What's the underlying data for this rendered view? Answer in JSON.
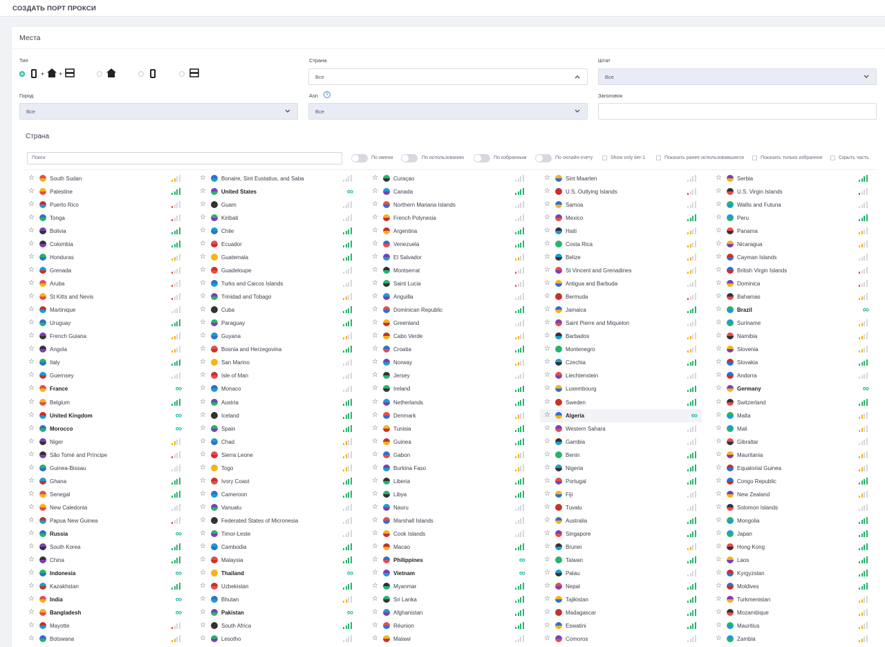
{
  "page_title": "СОЗДАТЬ ПОРТ ПРОКСИ",
  "card_title": "Места",
  "filters": {
    "type_label": "Тип",
    "country_label": "Страна",
    "country_value": "Все",
    "state_label": "Штат",
    "state_value": "Все",
    "city_label": "Город",
    "city_value": "Все",
    "asn_label": "Asn",
    "asn_value": "Все",
    "header_label": "Заголовок",
    "header_value": ""
  },
  "country_section": {
    "title": "Страна",
    "search_placeholder": "Поиск",
    "toggles": [
      "По имени",
      "По использованию",
      "По избранным",
      "По онлайн-счету"
    ],
    "checkboxes": [
      "Show only tier-1",
      "Показать ранее использовавшиеся",
      "Показать только избранное",
      "Скрыть часть"
    ]
  },
  "colors": {
    "accent": "#1fb7a0",
    "green": "#27b36b",
    "orange": "#f5b21a",
    "red": "#e84c4c",
    "grey": "#d5d7dd"
  },
  "columns": [
    [
      {
        "n": "South Sudan",
        "s": "o1"
      },
      {
        "n": "Palestine",
        "s": "g4"
      },
      {
        "n": "Puerto Rico",
        "s": "r1"
      },
      {
        "n": "Tonga",
        "s": "r1"
      },
      {
        "n": "Bolivia",
        "s": "g4"
      },
      {
        "n": "Colombia",
        "s": "g4"
      },
      {
        "n": "Honduras",
        "s": "o2"
      },
      {
        "n": "Grenada",
        "s": "r1"
      },
      {
        "n": "Aruba",
        "s": "r1"
      },
      {
        "n": "St Kitts and Nevis",
        "s": "r1"
      },
      {
        "n": "Martinique",
        "s": "x0"
      },
      {
        "n": "Uruguay",
        "s": "g4"
      },
      {
        "n": "French Guiana",
        "s": "o2"
      },
      {
        "n": "Angola",
        "s": "o2"
      },
      {
        "n": "Italy",
        "s": "g4"
      },
      {
        "n": "Guernsey",
        "s": "x0"
      },
      {
        "n": "France",
        "s": "inf",
        "b": true
      },
      {
        "n": "Belgium",
        "s": "g4"
      },
      {
        "n": "United Kingdom",
        "s": "inf",
        "b": true
      },
      {
        "n": "Morocco",
        "s": "inf",
        "b": true
      },
      {
        "n": "Niger",
        "s": "o2"
      },
      {
        "n": "São Tomé and Príncipe",
        "s": "r1"
      },
      {
        "n": "Guinea-Bissau",
        "s": "x0"
      },
      {
        "n": "Ghana",
        "s": "g4"
      },
      {
        "n": "Senegal",
        "s": "g4"
      },
      {
        "n": "New Caledonia",
        "s": "x0"
      },
      {
        "n": "Papua New Guinea",
        "s": "r1"
      },
      {
        "n": "Russia",
        "s": "inf",
        "b": true
      },
      {
        "n": "South Korea",
        "s": "g4"
      },
      {
        "n": "China",
        "s": "g4"
      },
      {
        "n": "Indonesia",
        "s": "inf",
        "b": true
      },
      {
        "n": "Kazakhstan",
        "s": "g4"
      },
      {
        "n": "India",
        "s": "inf",
        "b": true
      },
      {
        "n": "Bangladesh",
        "s": "inf",
        "b": true
      },
      {
        "n": "Mayotte",
        "s": "r1"
      },
      {
        "n": "Botswana",
        "s": "o2"
      }
    ],
    [
      {
        "n": "Bonaire, Sint Eustatius, and Saba",
        "s": "x0"
      },
      {
        "n": "United States",
        "s": "inf",
        "b": true
      },
      {
        "n": "Guam",
        "s": "x0"
      },
      {
        "n": "Kiribati",
        "s": "x0"
      },
      {
        "n": "Chile",
        "s": "g4"
      },
      {
        "n": "Ecuador",
        "s": "g4"
      },
      {
        "n": "Guatemala",
        "s": "g4"
      },
      {
        "n": "Guadeloupe",
        "s": "x0"
      },
      {
        "n": "Turks and Caicos Islands",
        "s": "x0"
      },
      {
        "n": "Trinidad and Tobago",
        "s": "o2"
      },
      {
        "n": "Cuba",
        "s": "g4"
      },
      {
        "n": "Paraguay",
        "s": "g4"
      },
      {
        "n": "Guyana",
        "s": "o2"
      },
      {
        "n": "Bosnia and Herzegovina",
        "s": "g4"
      },
      {
        "n": "San Marino",
        "s": "x0"
      },
      {
        "n": "Isle of Man",
        "s": "x0"
      },
      {
        "n": "Monaco",
        "s": "x0"
      },
      {
        "n": "Austria",
        "s": "g4"
      },
      {
        "n": "Iceland",
        "s": "g4"
      },
      {
        "n": "Spain",
        "s": "g4"
      },
      {
        "n": "Chad",
        "s": "o2"
      },
      {
        "n": "Sierra Leone",
        "s": "o2"
      },
      {
        "n": "Togo",
        "s": "o2"
      },
      {
        "n": "Ivory Coast",
        "s": "g4"
      },
      {
        "n": "Cameroon",
        "s": "g4"
      },
      {
        "n": "Vanuatu",
        "s": "x0"
      },
      {
        "n": "Federated States of Micronesia",
        "s": "x0"
      },
      {
        "n": "Timor-Leste",
        "s": "x0"
      },
      {
        "n": "Cambodia",
        "s": "g4"
      },
      {
        "n": "Malaysia",
        "s": "g4"
      },
      {
        "n": "Thailand",
        "s": "inf",
        "b": true
      },
      {
        "n": "Uzbekistan",
        "s": "g4"
      },
      {
        "n": "Bhutan",
        "s": "o2"
      },
      {
        "n": "Pakistan",
        "s": "inf",
        "b": true
      },
      {
        "n": "South Africa",
        "s": "g4"
      },
      {
        "n": "Lesotho",
        "s": "x0"
      }
    ],
    [
      {
        "n": "Curaçao",
        "s": "x0"
      },
      {
        "n": "Canada",
        "s": "g4"
      },
      {
        "n": "Northern Mariana Islands",
        "s": "x0"
      },
      {
        "n": "French Polynesia",
        "s": "x0"
      },
      {
        "n": "Argentina",
        "s": "g4"
      },
      {
        "n": "Venezuela",
        "s": "g4"
      },
      {
        "n": "El Salvador",
        "s": "o2"
      },
      {
        "n": "Montserrat",
        "s": "r1"
      },
      {
        "n": "Saint Lucia",
        "s": "r1"
      },
      {
        "n": "Anguilla",
        "s": "x0"
      },
      {
        "n": "Dominican Republic",
        "s": "g4"
      },
      {
        "n": "Greenland",
        "s": "x0"
      },
      {
        "n": "Cabo Verde",
        "s": "o2"
      },
      {
        "n": "Croatia",
        "s": "g4"
      },
      {
        "n": "Norway",
        "s": "o2"
      },
      {
        "n": "Jersey",
        "s": "x0"
      },
      {
        "n": "Ireland",
        "s": "g4"
      },
      {
        "n": "Netherlands",
        "s": "g4"
      },
      {
        "n": "Denmark",
        "s": "o2"
      },
      {
        "n": "Tunisia",
        "s": "g4"
      },
      {
        "n": "Guinea",
        "s": "g4"
      },
      {
        "n": "Gabon",
        "s": "o2"
      },
      {
        "n": "Burkina Faso",
        "s": "o2"
      },
      {
        "n": "Liberia",
        "s": "g4"
      },
      {
        "n": "Libya",
        "s": "g4"
      },
      {
        "n": "Nauru",
        "s": "x0"
      },
      {
        "n": "Marshall Islands",
        "s": "x0"
      },
      {
        "n": "Cook Islands",
        "s": "x0"
      },
      {
        "n": "Macao",
        "s": "g4"
      },
      {
        "n": "Philippines",
        "s": "inf",
        "b": true
      },
      {
        "n": "Vietnam",
        "s": "inf",
        "b": true
      },
      {
        "n": "Myanmar",
        "s": "g4"
      },
      {
        "n": "Sri Lanka",
        "s": "g4"
      },
      {
        "n": "Afghanistan",
        "s": "g4"
      },
      {
        "n": "Réunion",
        "s": "g4"
      },
      {
        "n": "Malawi",
        "s": "x0"
      }
    ],
    [
      {
        "n": "Sint Maarten",
        "s": "x0"
      },
      {
        "n": "U.S. Outlying Islands",
        "s": "r1"
      },
      {
        "n": "Samoa",
        "s": "x0"
      },
      {
        "n": "Mexico",
        "s": "g4"
      },
      {
        "n": "Haiti",
        "s": "o2"
      },
      {
        "n": "Costa Rica",
        "s": "o2"
      },
      {
        "n": "Belize",
        "s": "o2"
      },
      {
        "n": "St Vincent and Grenadines",
        "s": "o2"
      },
      {
        "n": "Antigua and Barbuda",
        "s": "x0"
      },
      {
        "n": "Bermuda",
        "s": "r1"
      },
      {
        "n": "Jamaica",
        "s": "g4"
      },
      {
        "n": "Saint Pierre and Miquelon",
        "s": "x0"
      },
      {
        "n": "Barbados",
        "s": "o2"
      },
      {
        "n": "Montenegro",
        "s": "o2"
      },
      {
        "n": "Czechia",
        "s": "g4"
      },
      {
        "n": "Liechtenstein",
        "s": "x0"
      },
      {
        "n": "Luxembourg",
        "s": "g4"
      },
      {
        "n": "Sweden",
        "s": "g4"
      },
      {
        "n": "Algeria",
        "s": "inf",
        "b": true,
        "hl": true
      },
      {
        "n": "Western Sahara",
        "s": "x0"
      },
      {
        "n": "Gambia",
        "s": "x0"
      },
      {
        "n": "Benin",
        "s": "g4"
      },
      {
        "n": "Nigeria",
        "s": "g4"
      },
      {
        "n": "Portugal",
        "s": "g4"
      },
      {
        "n": "Fiji",
        "s": "x0"
      },
      {
        "n": "Tuvalu",
        "s": "x0"
      },
      {
        "n": "Australia",
        "s": "g4"
      },
      {
        "n": "Singapore",
        "s": "g4"
      },
      {
        "n": "Brunei",
        "s": "o2"
      },
      {
        "n": "Taiwan",
        "s": "g4"
      },
      {
        "n": "Palau",
        "s": "x0"
      },
      {
        "n": "Nepal",
        "s": "g4"
      },
      {
        "n": "Tajikistan",
        "s": "g4"
      },
      {
        "n": "Madagascar",
        "s": "g4"
      },
      {
        "n": "Eswatini",
        "s": "g4"
      },
      {
        "n": "Comoros",
        "s": "x0"
      }
    ],
    [
      {
        "n": "Serbia",
        "s": "g4"
      },
      {
        "n": "U.S. Virgin Islands",
        "s": "r1"
      },
      {
        "n": "Wallis and Futuna",
        "s": "x0"
      },
      {
        "n": "Peru",
        "s": "g4"
      },
      {
        "n": "Panama",
        "s": "o2"
      },
      {
        "n": "Nicaragua",
        "s": "o2"
      },
      {
        "n": "Cayman Islands",
        "s": "x0"
      },
      {
        "n": "British Virgin Islands",
        "s": "r1"
      },
      {
        "n": "Dominica",
        "s": "r1"
      },
      {
        "n": "Bahamas",
        "s": "o2"
      },
      {
        "n": "Brazil",
        "s": "inf",
        "b": true
      },
      {
        "n": "Suriname",
        "s": "o2"
      },
      {
        "n": "Namibia",
        "s": "o2"
      },
      {
        "n": "Slovenia",
        "s": "o2"
      },
      {
        "n": "Slovakia",
        "s": "g4"
      },
      {
        "n": "Andorra",
        "s": "x0"
      },
      {
        "n": "Germany",
        "s": "inf",
        "b": true
      },
      {
        "n": "Switzerland",
        "s": "g4"
      },
      {
        "n": "Malta",
        "s": "o2"
      },
      {
        "n": "Mali",
        "s": "o2"
      },
      {
        "n": "Gibraltar",
        "s": "x0"
      },
      {
        "n": "Mauritania",
        "s": "o2"
      },
      {
        "n": "Equatorial Guinea",
        "s": "o2"
      },
      {
        "n": "Congo Republic",
        "s": "g4"
      },
      {
        "n": "New Zealand",
        "s": "o2"
      },
      {
        "n": "Solomon Islands",
        "s": "x0"
      },
      {
        "n": "Mongolia",
        "s": "g4"
      },
      {
        "n": "Japan",
        "s": "g4"
      },
      {
        "n": "Hong Kong",
        "s": "g4"
      },
      {
        "n": "Laos",
        "s": "g4"
      },
      {
        "n": "Kyrgyzstan",
        "s": "g4"
      },
      {
        "n": "Moldives",
        "s": "g4"
      },
      {
        "n": "Turkmenistan",
        "s": "o2"
      },
      {
        "n": "Mozambique",
        "s": "o2"
      },
      {
        "n": "Mauritius",
        "s": "o2"
      },
      {
        "n": "Zambia",
        "s": "o2"
      }
    ]
  ]
}
